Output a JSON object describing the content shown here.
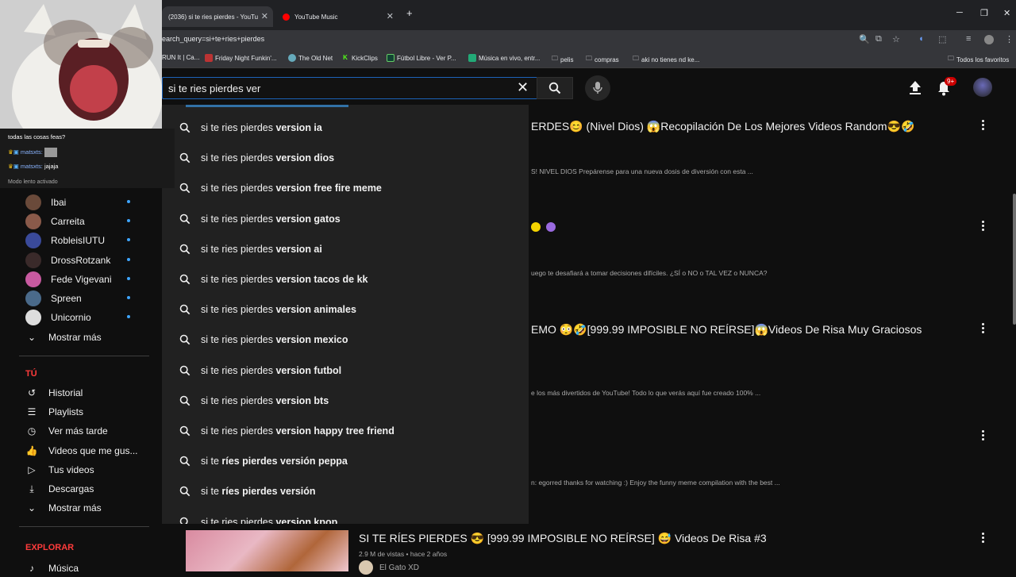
{
  "browser": {
    "tabs": [
      {
        "title": "(2036) si te ries pierdes - YouTu"
      },
      {
        "title": "YouTube Music"
      }
    ],
    "new_tab": "+",
    "url": "earch_query=si+te+ries+pierdes",
    "bookmarks": [
      "RUN It | Ca...",
      "Friday Night Funkin'...",
      "The Old Net",
      "KickClips",
      "Fútbol Libre - Ver P...",
      "Música en vivo, entr...",
      "pelis",
      "compras",
      "aki no tienes nd ke...",
      "Todos los favoritos"
    ]
  },
  "header": {
    "search_value": "si te ries pierdes ver",
    "notif_badge": "9+"
  },
  "suggestions": [
    {
      "prefix": "si te ries pierdes ",
      "bold": "version ia"
    },
    {
      "prefix": "si te ries pierdes ",
      "bold": "version dios"
    },
    {
      "prefix": "si te ries pierdes ",
      "bold": "version free fire meme"
    },
    {
      "prefix": "si te ries pierdes ",
      "bold": "version gatos"
    },
    {
      "prefix": "si te ries pierdes ",
      "bold": "version ai"
    },
    {
      "prefix": "si te ries pierdes ",
      "bold": "version tacos de kk"
    },
    {
      "prefix": "si te ries pierdes ",
      "bold": "version animales"
    },
    {
      "prefix": "si te ries pierdes ",
      "bold": "version mexico"
    },
    {
      "prefix": "si te ries pierdes ",
      "bold": "version futbol"
    },
    {
      "prefix": "si te ries pierdes ",
      "bold": "version bts"
    },
    {
      "prefix": "si te ries pierdes ",
      "bold": "version happy tree friend"
    },
    {
      "prefix": "si te ",
      "bold": "ríes pierdes versión peppa"
    },
    {
      "prefix": "si te ",
      "bold": "ríes pierdes versión"
    },
    {
      "prefix": "si te ries pierdes ",
      "bold": "version kpop"
    }
  ],
  "chat": {
    "line1": "todas las cosas feas?",
    "line2_user": "matsxts:",
    "line3_user": "matsxts:",
    "line3_msg": "jajaja",
    "slow_mode": "Modo lento activado"
  },
  "sidebar": {
    "subscriptions": [
      {
        "name": "Ibai",
        "color": "#6a4a3a"
      },
      {
        "name": "Carreita",
        "color": "#8a5a4a"
      },
      {
        "name": "RobleisIUTU",
        "color": "#3a4a9a"
      },
      {
        "name": "DrossRotzank",
        "color": "#3a2a2a"
      },
      {
        "name": "Fede Vigevani",
        "color": "#c85aa0"
      },
      {
        "name": "Spreen",
        "color": "#4a6a8a"
      },
      {
        "name": "Unicornio",
        "color": "#dddddd"
      }
    ],
    "show_more": "Mostrar más",
    "you_header": "TÚ",
    "you_items": [
      "Historial",
      "Playlists",
      "Ver más tarde",
      "Videos que me gus...",
      "Tus videos",
      "Descargas"
    ],
    "show_more_2": "Mostrar más",
    "explore_header": "EXPLORAR",
    "explore_items": [
      "Música"
    ]
  },
  "results": [
    {
      "title": "ERDES😊 (Nivel Dios) 😱Recopilación De Los Mejores Videos Random😎🤣",
      "desc": "S! NIVEL DIOS Prepárense para una nueva dosis de diversión con esta ..."
    },
    {
      "title": "",
      "desc": "uego te desafiará a tomar decisiones difíciles. ¿SÍ o NO o TAL VEZ o NUNCA?"
    },
    {
      "title": "EMO 😳🤣[999.99 IMPOSIBLE NO REÍRSE]😱Videos De Risa Muy Graciosos",
      "desc": "e los más divertidos de YouTube! Todo lo que verás aquí fue creado 100% ..."
    },
    {
      "title": "",
      "desc": "n: egorred thanks for watching :) Enjoy the funny meme compilation with the best ..."
    }
  ],
  "bottom_result": {
    "title": "SI TE RÍES PIERDES 😎 [999.99 IMPOSIBLE NO REÍRSE] 😅 Videos De Risa #3",
    "meta": "2.9 M de vistas • hace 2 años",
    "channel": "El Gato XD"
  },
  "colors": {
    "accent": "#3ea6ff",
    "brand_red": "#ff0000"
  }
}
